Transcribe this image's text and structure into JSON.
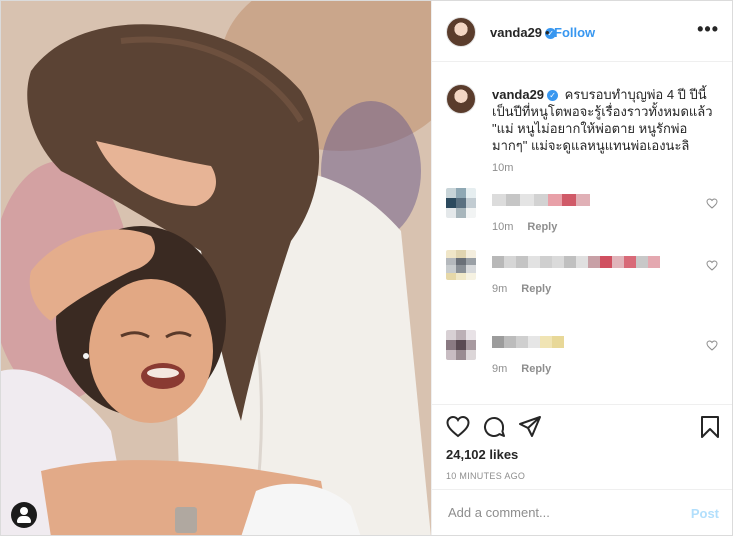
{
  "header": {
    "username": "vanda29",
    "verified_symbol": "✓",
    "separator": "•",
    "follow_label": "Follow",
    "more_symbol": "•••"
  },
  "caption": {
    "username": "vanda29",
    "text": "ครบรอบทำบุญพ่อ 4 ปี ปีนี้เป็นปีที่หนูโตพอจะรู้เรื่องราวทั้งหมดแล้ว \"แม่ หนูไม่อยากให้พ่อตาย หนูรักพ่อมากๆ\" แม่จะดูแลหนูแทนพ่อเองนะลิ",
    "time": "10m"
  },
  "comments": [
    {
      "time": "10m",
      "reply_label": "Reply"
    },
    {
      "time": "9m",
      "reply_label": "Reply"
    },
    {
      "time": "9m",
      "reply_label": "Reply"
    }
  ],
  "likes": "24,102 likes",
  "time_ago": "10 MINUTES AGO",
  "add_comment": {
    "placeholder": "Add a comment...",
    "post_label": "Post"
  },
  "colors": {
    "accent": "#3897f0",
    "muted": "#8e8e8e",
    "post_disabled": "#b2dffc"
  }
}
